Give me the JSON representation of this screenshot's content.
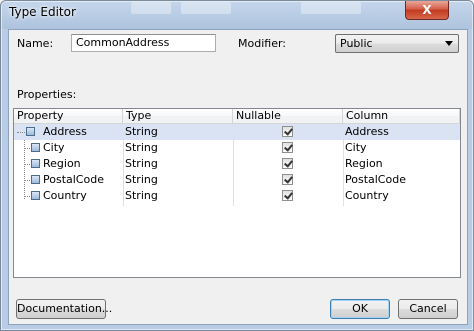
{
  "window": {
    "title": "Type Editor",
    "close_glyph": "X"
  },
  "form": {
    "name_label": "Name:",
    "name_value": "CommonAddress",
    "modifier_label": "Modifier:",
    "modifier_value": "Public",
    "properties_label": "Properties:"
  },
  "grid": {
    "columns": [
      "Property",
      "Type",
      "Nullable",
      "Column"
    ],
    "rows": [
      {
        "property": "Address",
        "type": "String",
        "nullable": true,
        "column": "Address",
        "selected": true
      },
      {
        "property": "City",
        "type": "String",
        "nullable": true,
        "column": "City",
        "selected": false
      },
      {
        "property": "Region",
        "type": "String",
        "nullable": true,
        "column": "Region",
        "selected": false
      },
      {
        "property": "PostalCode",
        "type": "String",
        "nullable": true,
        "column": "PostalCode",
        "selected": false
      },
      {
        "property": "Country",
        "type": "String",
        "nullable": true,
        "column": "Country",
        "selected": false
      }
    ]
  },
  "buttons": {
    "documentation": "Documentation...",
    "ok": "OK",
    "cancel": "Cancel"
  },
  "colors": {
    "selection": "#d9e3f3",
    "title_gradient_top": "#c4d6ec"
  }
}
